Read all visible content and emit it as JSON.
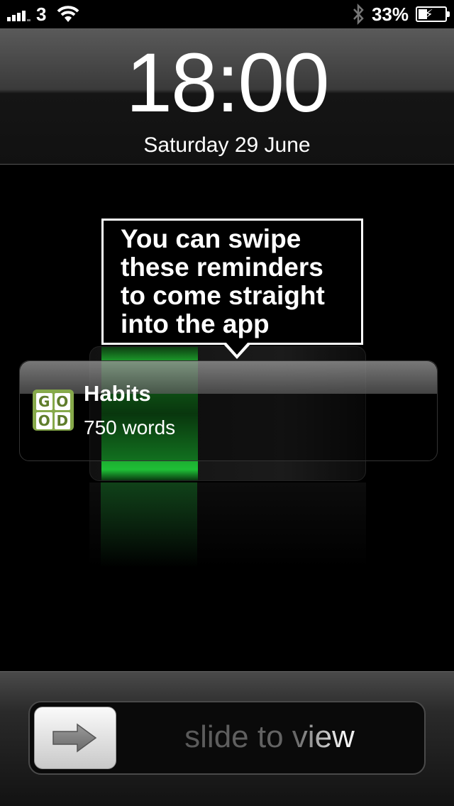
{
  "status_bar": {
    "carrier": "3",
    "battery_percent": "33%",
    "signal_bars": 4,
    "icons": [
      "signal-icon",
      "wifi-icon",
      "bluetooth-icon",
      "battery-icon"
    ]
  },
  "lock_screen": {
    "time": "18:00",
    "date": "Saturday 29 June"
  },
  "callout": {
    "text": "You  can swipe these reminders to come straight into the app"
  },
  "notification": {
    "app_icon_letters": [
      "G",
      "O",
      "O",
      "D"
    ],
    "title": "Habits",
    "body": "750 words"
  },
  "slider": {
    "label": "slide to view",
    "icon": "arrow-right-icon"
  },
  "colors": {
    "battery_green": "#1fa62e",
    "app_icon_green": "#86a94a"
  }
}
